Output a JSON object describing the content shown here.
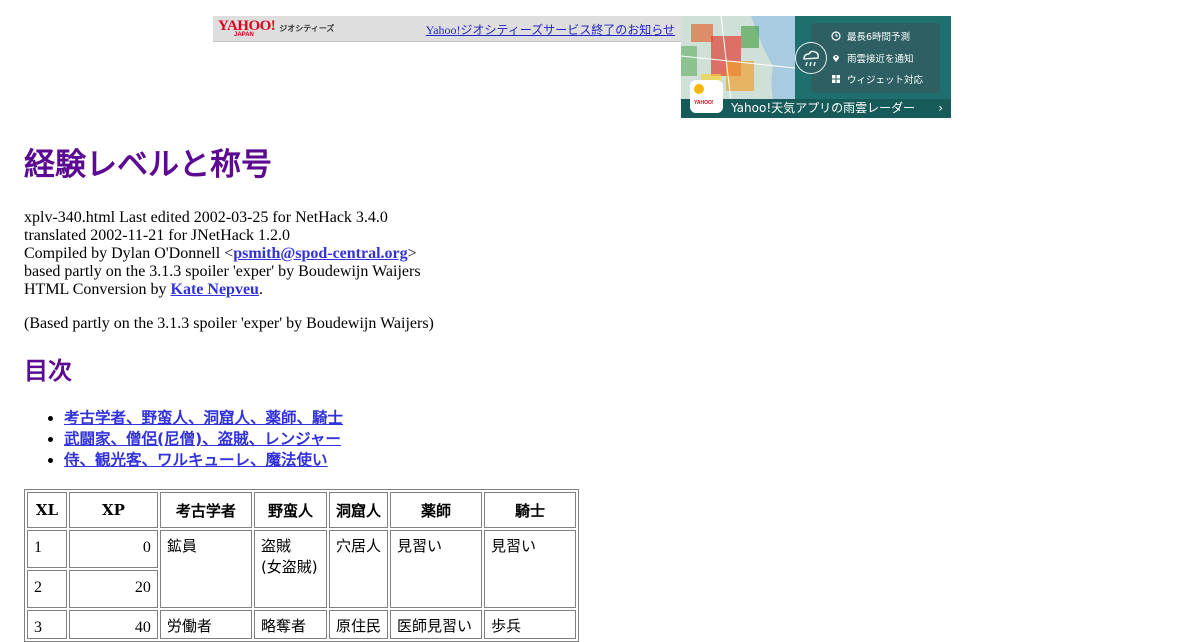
{
  "banner": {
    "logo": "YAHOO!",
    "logo_sub": "JAPAN",
    "logo_service": "ジオシティーズ",
    "notice": "Yahoo!ジオシティーズサービス終了のお知らせ"
  },
  "ad": {
    "features": [
      "最長6時間予測",
      "雨雲接近を通知",
      "ウィジェット対応"
    ],
    "app_label": "YAHOO!",
    "cta": "Yahoo!天気アプリの雨雲レーダー",
    "cta_arrow": "›",
    "accent": "#165a5a"
  },
  "page": {
    "title": "経験レベルと称号",
    "meta": {
      "line1": "xplv-340.html Last edited 2002-03-25 for NetHack 3.4.0",
      "line2": "translated 2002-11-21 for JNetHack 1.2.0",
      "line3_prefix": "Compiled by Dylan O'Donnell <",
      "email": "psmith@spod-central.org",
      "line3_suffix": ">",
      "line4": "based partly on the 3.1.3 spoiler 'exper' by Boudewijn Waijers",
      "line5_prefix": "HTML Conversion by ",
      "converter": "Kate Nepveu",
      "line5_suffix": "."
    },
    "based_note": "(Based partly on the 3.1.3 spoiler 'exper' by Boudewijn Waijers)",
    "toc_title": "目次",
    "toc": [
      "考古学者、野蛮人、洞窟人、薬師、騎士",
      "武闘家、僧侶(尼僧)、盗賊、レンジャー",
      "侍、観光客、ワルキューレ、魔法使い"
    ]
  },
  "table": {
    "headers": [
      "XL",
      "XP",
      "考古学者",
      "野蛮人",
      "洞窟人",
      "薬師",
      "騎士"
    ],
    "rows": [
      {
        "xl": "1",
        "xp": "0"
      },
      {
        "xl": "2",
        "xp": "20"
      },
      {
        "xl": "3",
        "xp": "40"
      }
    ],
    "titles_1_2": {
      "archeologist": "鉱員",
      "barbarian_1": "盗賊",
      "barbarian_2": "(女盗賊)",
      "caveman": "穴居人",
      "healer": "見習い",
      "knight": "見習い"
    },
    "titles_3": {
      "archeologist": "労働者",
      "barbarian": "略奪者",
      "caveman": "原住民",
      "healer": "医師見習い",
      "knight": "歩兵"
    }
  },
  "colors": {
    "heading": "#5c0a91",
    "link": "#3232dc",
    "banner_bg": "#dedede",
    "yahoo_red": "#e0001b"
  }
}
